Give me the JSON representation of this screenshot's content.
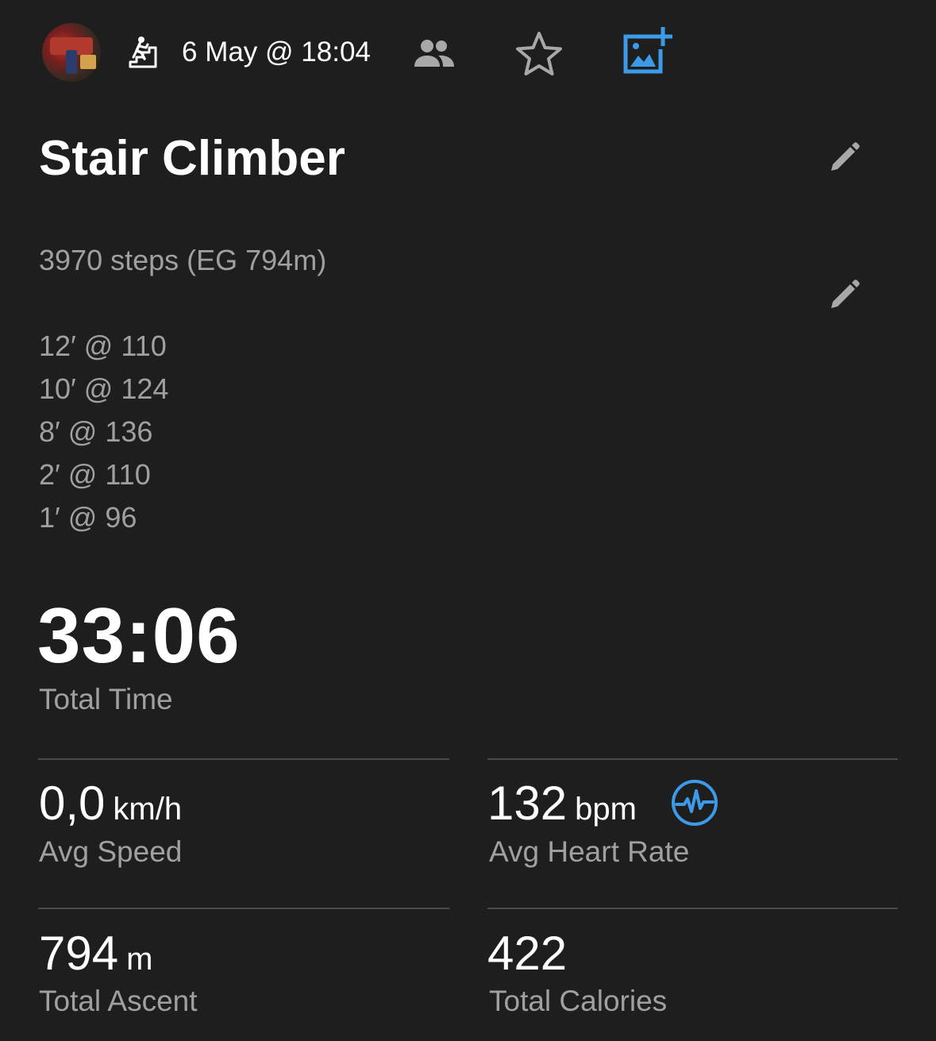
{
  "header": {
    "date": "6 May @ 18:04",
    "icons": [
      "avatar",
      "stair-climber-icon",
      "people-icon",
      "star-icon",
      "add-photo-icon"
    ]
  },
  "activity": {
    "title": "Stair Climber",
    "description_lines": [
      "3970 steps (EG 794m)",
      "12′ @ 110",
      "10′ @ 124",
      "8′ @ 136",
      "2′ @ 110",
      "1′ @ 96"
    ]
  },
  "summary": {
    "total_time": "33:06",
    "total_time_label": "Total Time"
  },
  "stats": {
    "avg_speed": {
      "value": "0,0",
      "unit": "km/h",
      "label": "Avg Speed"
    },
    "avg_heart_rate": {
      "value": "132",
      "unit": "bpm",
      "label": "Avg Heart Rate"
    },
    "total_ascent": {
      "value": "794",
      "unit": "m",
      "label": "Total Ascent"
    },
    "total_calories": {
      "value": "422",
      "label": "Total Calories"
    }
  },
  "colors": {
    "background": "#1e1e1e",
    "accent_blue": "#3d9ae8",
    "secondary_text": "#a0a0a0",
    "icon_gray": "#a8a8a8"
  }
}
